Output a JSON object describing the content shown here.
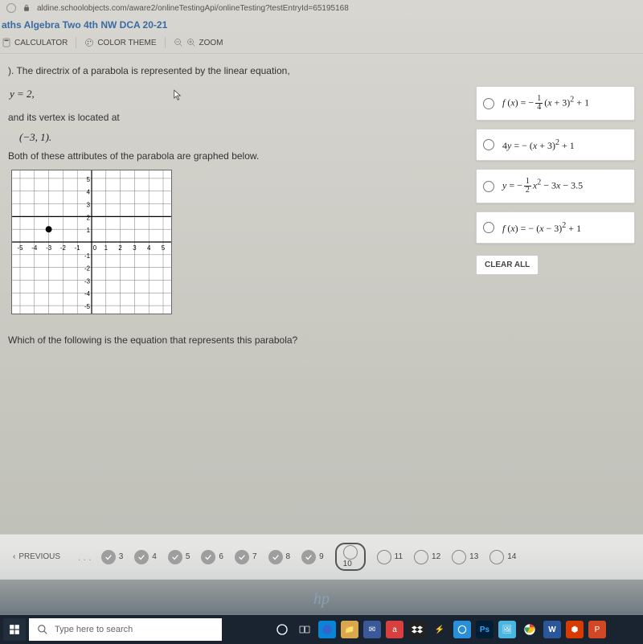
{
  "url": "aldine.schoolobjects.com/aware2/onlineTestingApi/onlineTesting?testEntryId=65195168",
  "breadcrumb": "aths Algebra Two 4th NW DCA 20-21",
  "toolbar": {
    "calculator": "CALCULATOR",
    "theme": "COLOR THEME",
    "zoom": "ZOOM"
  },
  "question": {
    "number_prefix": "). ",
    "prompt": "The directrix of a parabola is represented by the linear equation,",
    "directrix_eq": "y = 2,",
    "vertex_intro": "and its vertex is located at",
    "vertex": "(−3, 1).",
    "both_text": "Both of these attributes of the parabola are graphed below.",
    "followup": "Which of the following is the equation that represents this parabola?"
  },
  "options": {
    "a": "f (x) = −¼ (x + 3)² + 1",
    "b": "4y = − (x + 3)² + 1",
    "c": "y = −½ x² − 3x − 3.5",
    "d": "f (x) = − (x − 3)² + 1"
  },
  "clear": "CLEAR ALL",
  "pager": {
    "previous": "PREVIOUS",
    "items": [
      {
        "n": "3",
        "state": "done"
      },
      {
        "n": "4",
        "state": "done"
      },
      {
        "n": "5",
        "state": "done"
      },
      {
        "n": "6",
        "state": "done"
      },
      {
        "n": "7",
        "state": "done"
      },
      {
        "n": "8",
        "state": "done"
      },
      {
        "n": "9",
        "state": "done"
      },
      {
        "n": "10",
        "state": "current"
      },
      {
        "n": "11",
        "state": "pending"
      },
      {
        "n": "12",
        "state": "pending"
      },
      {
        "n": "13",
        "state": "pending"
      },
      {
        "n": "14",
        "state": "pending"
      }
    ]
  },
  "taskbar": {
    "search_placeholder": "Type here to search"
  },
  "brand": "hp",
  "chart_data": {
    "type": "scatter",
    "title": "",
    "xlabel": "",
    "ylabel": "",
    "xlim": [
      -5,
      5
    ],
    "ylim": [
      -5,
      5
    ],
    "grid": true,
    "series": [
      {
        "name": "vertex",
        "kind": "point",
        "points": [
          [
            -3,
            1
          ]
        ]
      },
      {
        "name": "directrix",
        "kind": "hline",
        "y": 2
      }
    ],
    "xticks": [
      -5,
      -4,
      -3,
      -2,
      -1,
      0,
      1,
      2,
      3,
      4,
      5
    ],
    "yticks": [
      -5,
      -4,
      -3,
      -2,
      -1,
      1,
      2,
      3,
      4,
      5
    ]
  }
}
